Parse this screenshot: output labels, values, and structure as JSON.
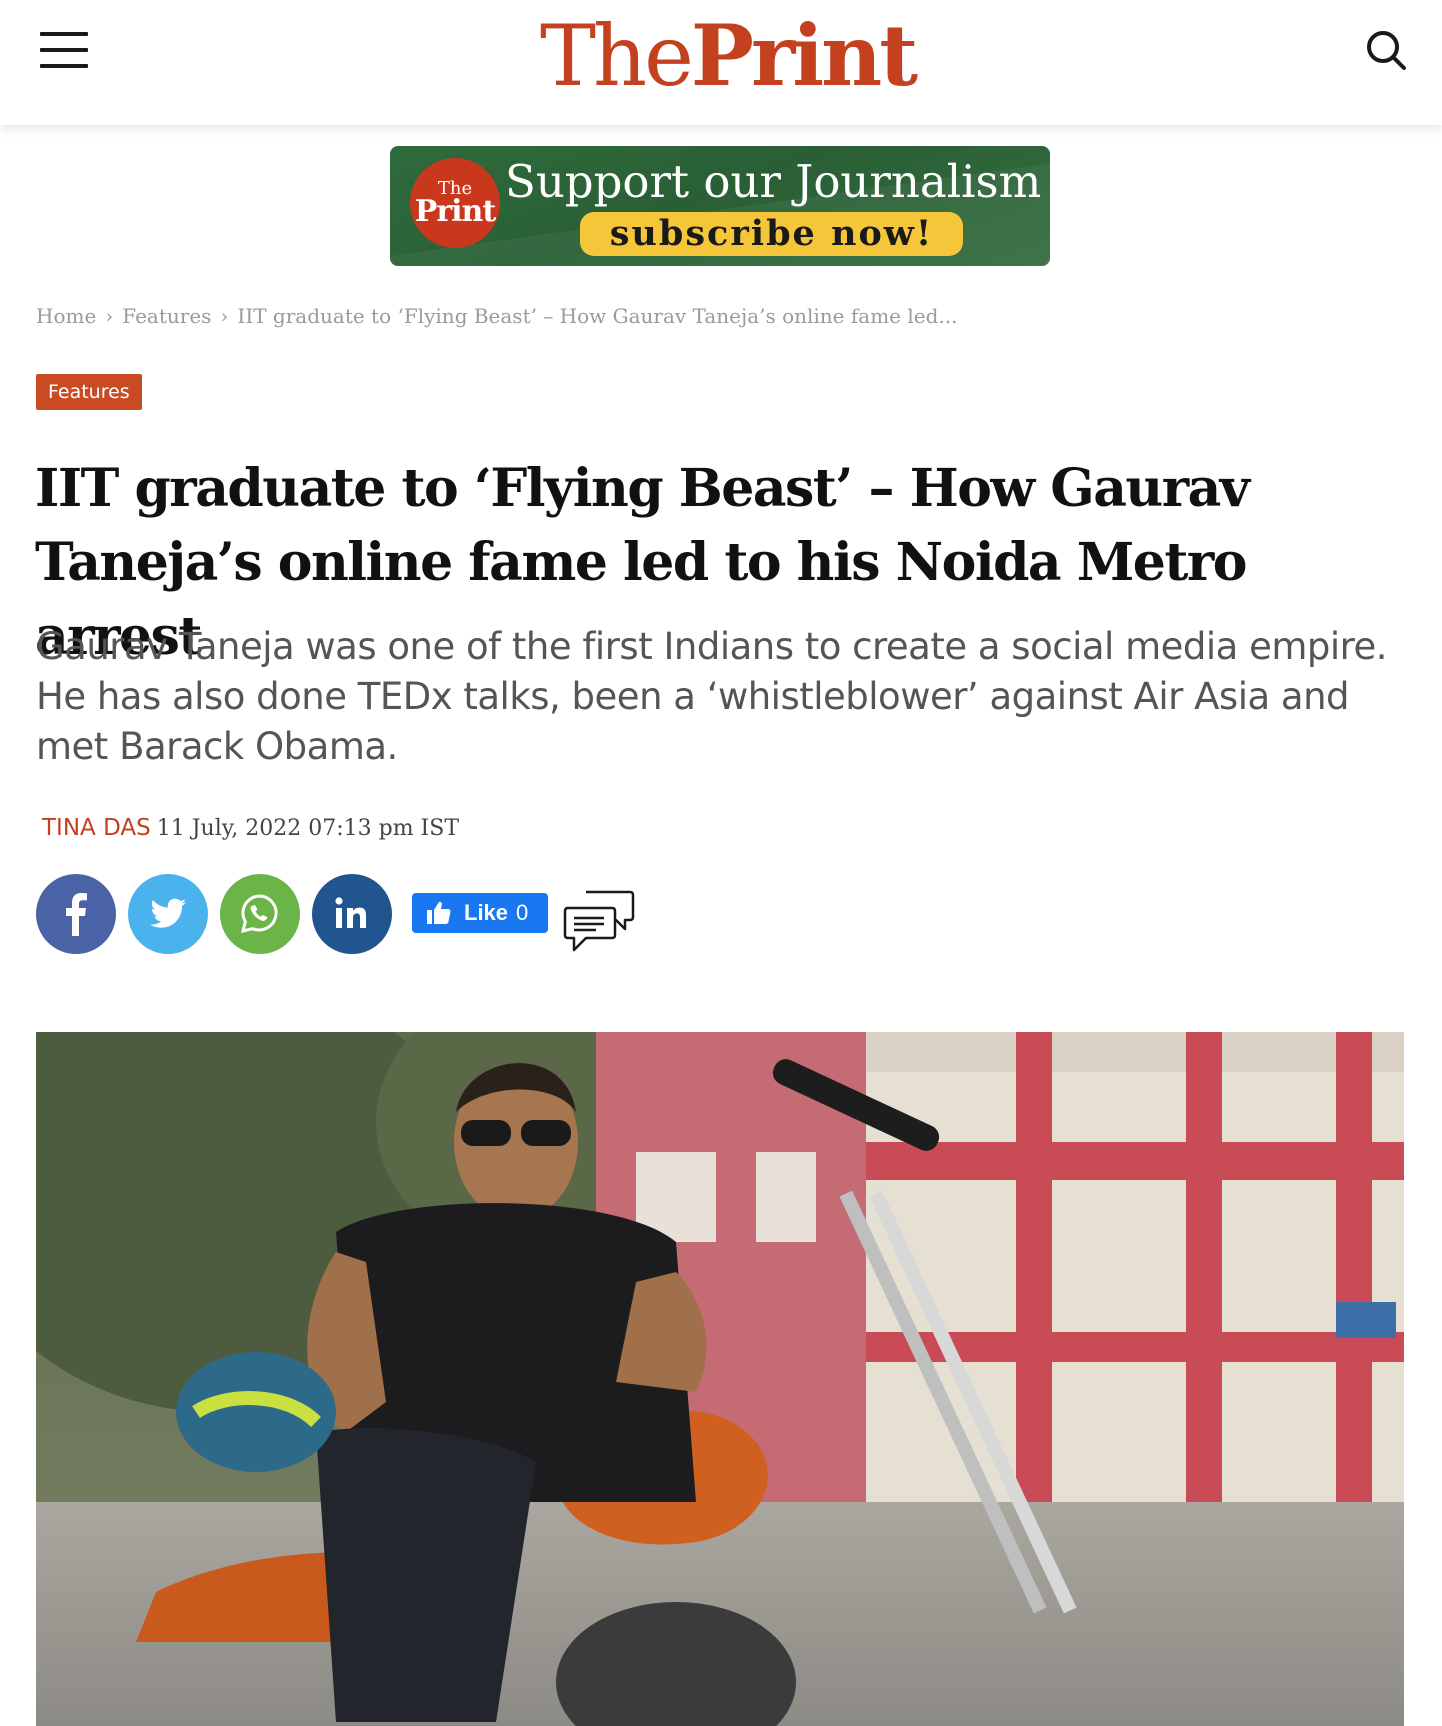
{
  "header": {
    "logo_part1": "The",
    "logo_part2": "Print",
    "brand_color": "#c4411f",
    "menu_icon": "hamburger-menu-icon",
    "search_icon": "search-icon"
  },
  "banner": {
    "badge_line1": "The",
    "badge_line2": "Print",
    "title": "Support our Journalism",
    "cta": "subscribe now!",
    "background_color": "#2f6b3c",
    "cta_color": "#f6c63a"
  },
  "breadcrumb": {
    "items": [
      "Home",
      "Features",
      "IIT graduate to ‘Flying Beast’ – How Gaurav Taneja’s online fame led..."
    ],
    "separator": "›"
  },
  "article": {
    "category": "Features",
    "headline": "IIT graduate to ‘Flying Beast’ – How Gaurav Taneja’s online fame led to his Noida Metro arrest",
    "dek": "Gaurav Taneja was one of the first Indians to create a social media empire. He has also done TEDx talks, been a ‘whistleblower’ against Air Asia and met Barack Obama.",
    "author": "TINA DAS",
    "date": "11 July, 2022 07:13 pm IST"
  },
  "share": {
    "facebook_icon": "facebook-icon",
    "twitter_icon": "twitter-icon",
    "whatsapp_icon": "whatsapp-icon",
    "linkedin_icon": "linkedin-icon",
    "like_label": "Like",
    "like_count": "0",
    "comments_icon": "comments-icon"
  },
  "hero": {
    "description": ""
  }
}
